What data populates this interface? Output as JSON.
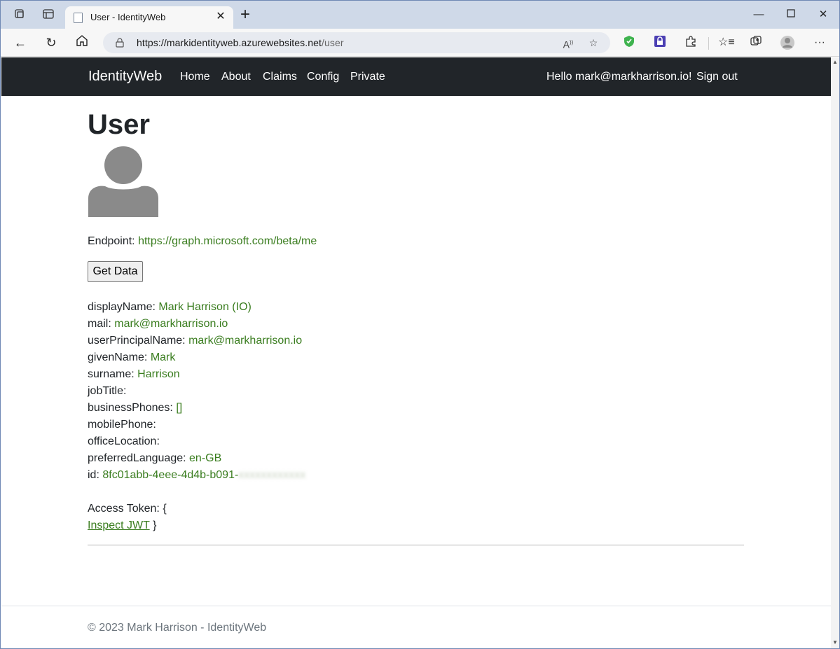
{
  "browser": {
    "tab_title": "User - IdentityWeb",
    "url_host": "https://markidentityweb.azurewebsites.net",
    "url_path": "/user"
  },
  "navbar": {
    "brand": "IdentityWeb",
    "links": [
      "Home",
      "About",
      "Claims",
      "Config",
      "Private"
    ],
    "greeting": "Hello mark@markharrison.io!",
    "signout": "Sign out"
  },
  "page": {
    "title": "User",
    "endpoint_label": "Endpoint:",
    "endpoint_value": "https://graph.microsoft.com/beta/me",
    "get_data_button": "Get Data",
    "fields": [
      {
        "label": "displayName:",
        "value": "Mark Harrison (IO)"
      },
      {
        "label": "mail:",
        "value": "mark@markharrison.io"
      },
      {
        "label": "userPrincipalName:",
        "value": "mark@markharrison.io"
      },
      {
        "label": "givenName:",
        "value": "Mark"
      },
      {
        "label": "surname:",
        "value": "Harrison"
      },
      {
        "label": "jobTitle:",
        "value": ""
      },
      {
        "label": "businessPhones:",
        "value": "[]"
      },
      {
        "label": "mobilePhone:",
        "value": ""
      },
      {
        "label": "officeLocation:",
        "value": ""
      },
      {
        "label": "preferredLanguage:",
        "value": "en-GB"
      },
      {
        "label": "id:",
        "value": "8fc01abb-4eee-4d4b-b091-",
        "value_blurred": "xxxxxxxxxxxx"
      }
    ],
    "access_token_label": "Access Token: {",
    "inspect_jwt_link": "Inspect JWT",
    "access_token_close": "}"
  },
  "footer": {
    "text": "© 2023 Mark Harrison - IdentityWeb"
  },
  "colors": {
    "navbar_bg": "#212529",
    "value_green": "#3a7d1f",
    "titlebar_bg": "#cfd9e8"
  }
}
